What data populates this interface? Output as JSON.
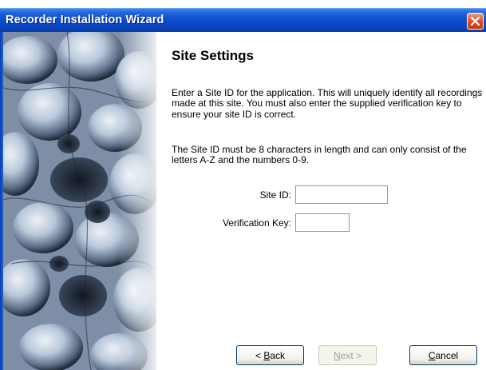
{
  "window": {
    "title": "Recorder Installation Wizard"
  },
  "page": {
    "heading": "Site Settings",
    "paragraph1": "Enter a Site ID for the application.  This will uniquely identify all recordings made at this site.  You must also enter the supplied verification key to ensure your site ID is correct.",
    "paragraph2": "The Site ID must be 8 characters in length and can only consist of the letters A-Z and the numbers 0-9."
  },
  "form": {
    "site_id_label": "Site ID:",
    "site_id_value": "",
    "verification_key_label": "Verification Key:",
    "verification_key_value": ""
  },
  "buttons": {
    "back": {
      "prefix": "< ",
      "mnemonic": "B",
      "rest": "ack"
    },
    "next": {
      "mnemonic": "N",
      "rest": "ext >",
      "enabled": false
    },
    "cancel": {
      "mnemonic": "C",
      "rest": "ancel"
    }
  },
  "icons": {
    "close": "close-icon"
  },
  "colors": {
    "titlebar": "#0a4bd0",
    "close_button": "#de4a1e",
    "input_border": "#7f9db9",
    "button_border": "#003c74"
  }
}
